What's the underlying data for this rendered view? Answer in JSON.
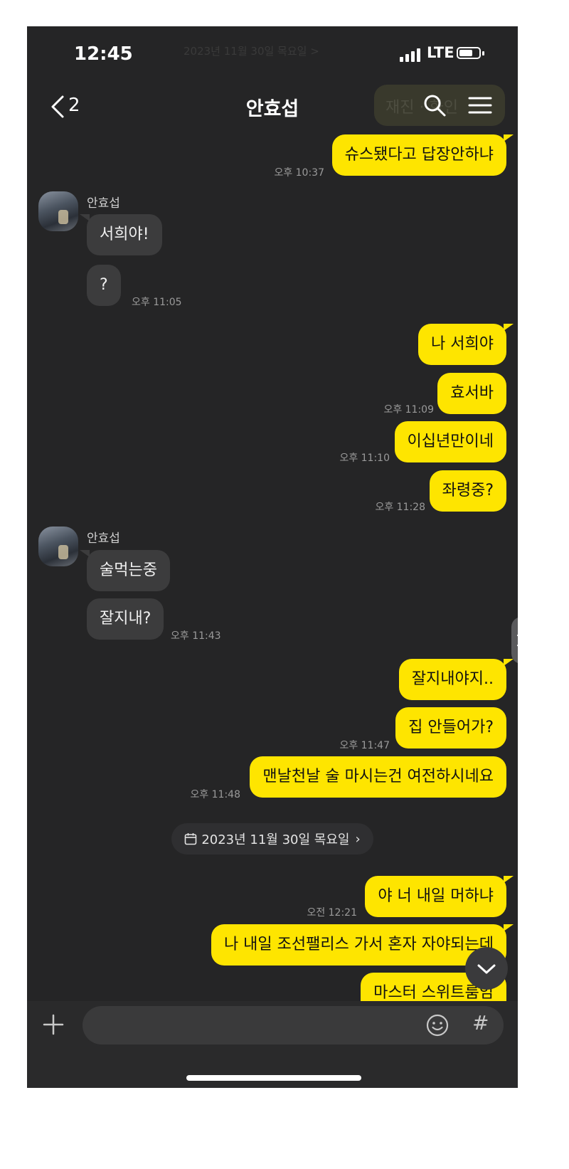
{
  "status_bar": {
    "time": "12:45",
    "network": "LTE",
    "ghost_date_text": "2023년 11월 30일 목요일 >"
  },
  "header": {
    "back_count": "2",
    "title": "안효섭",
    "ghost_bubble_text": "재진 · 화인",
    "icons": [
      "back-icon",
      "search-icon",
      "menu-icon"
    ]
  },
  "messages": [
    {
      "from": "me",
      "text": "슈스됐다고 답장안하냐",
      "time": "오후 10:37"
    },
    {
      "from": "other",
      "sender": "안효섭",
      "text": "서희야!",
      "time": ""
    },
    {
      "from": "other",
      "text": "?",
      "time": "오후 11:05"
    },
    {
      "from": "me",
      "text": "나 서희야",
      "time": ""
    },
    {
      "from": "me",
      "text": "효서바",
      "time": "오후 11:09"
    },
    {
      "from": "me",
      "text": "이십년만이네",
      "time": "오후 11:10"
    },
    {
      "from": "me",
      "text": "좌령중?",
      "time": "오후 11:28"
    },
    {
      "from": "other",
      "sender": "안효섭",
      "text": "술먹는중",
      "time": ""
    },
    {
      "from": "other",
      "text": "잘지내?",
      "time": "오후 11:43"
    },
    {
      "from": "me",
      "text": "잘지내야지..",
      "time": ""
    },
    {
      "from": "me",
      "text": "집 안들어가?",
      "time": "오후 11:47"
    },
    {
      "from": "me",
      "text": "맨날천날 술 마시는건 여전하시네요",
      "time": "오후 11:48"
    },
    {
      "from": "me",
      "text": "야 너 내일 머하냐",
      "time": "오전 12:21"
    },
    {
      "from": "me",
      "text": "나 내일 조선팰리스 가서 혼자 자야되는데",
      "time": ""
    },
    {
      "from": "me",
      "text": "마스터 스위트룸임",
      "time": ""
    }
  ],
  "date_divider": "2023년 11월 30일 목요일",
  "input_bar": {
    "placeholder": "",
    "icons": [
      "plus-icon",
      "emoji-icon",
      "hash-icon"
    ],
    "hash_glyph": "#"
  },
  "colors": {
    "background": "#252526",
    "my_bubble": "#fee500",
    "other_bubble": "#3c3c3d",
    "timestamp": "#9a9a9a"
  }
}
